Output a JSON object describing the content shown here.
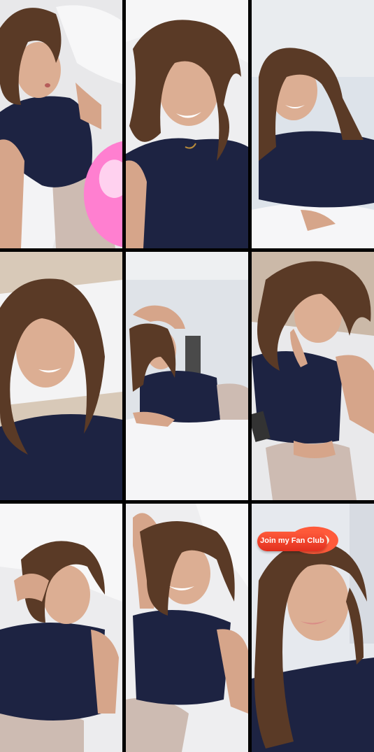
{
  "grid": {
    "columns": 3,
    "rows": 3,
    "tiles": [
      {
        "id": 1,
        "scene": "selfie on white bed, pouting, navy top, beige pants"
      },
      {
        "id": 2,
        "scene": "smiling close-up, messy hair, navy top"
      },
      {
        "id": 3,
        "scene": "smiling, leaning on bed, white wall behind"
      },
      {
        "id": 4,
        "scene": "tilted close-up smiling, white pillow behind"
      },
      {
        "id": 5,
        "scene": "lying on bed, arm raised over head"
      },
      {
        "id": 6,
        "scene": "finger on lips, reclining on bed"
      },
      {
        "id": 7,
        "scene": "hand in hair, lying on white sheets"
      },
      {
        "id": 8,
        "scene": "arm raised, grinning, on bed"
      },
      {
        "id": 9,
        "scene": "close-up smile with fan club sticker"
      }
    ]
  },
  "fan_club": {
    "label": "Join my Fan Club",
    "color": "#e7341f"
  },
  "colors": {
    "top": "#1d2342",
    "hair": "#5a3a26",
    "skin": "#d9a98c",
    "sheet": "#f0f0f2",
    "pants": "#c9b6ad",
    "gap": "#000000"
  }
}
